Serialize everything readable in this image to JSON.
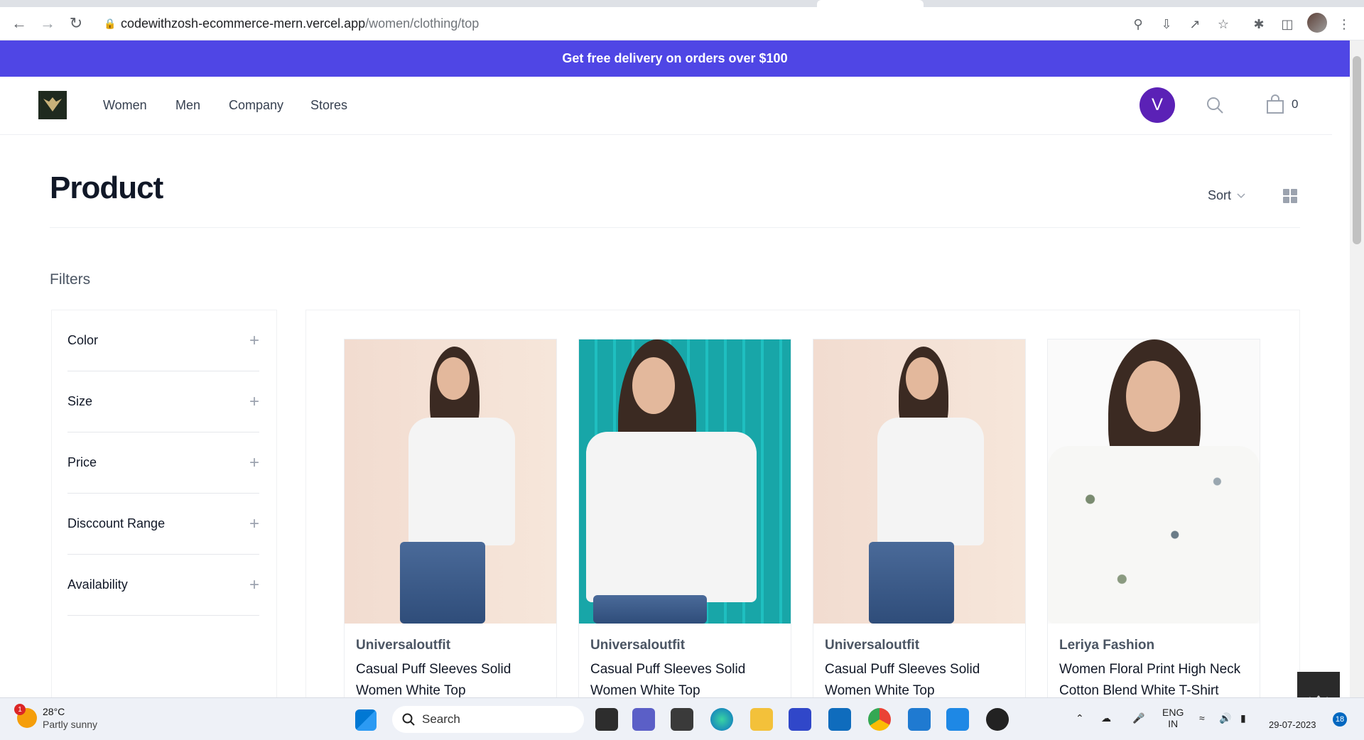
{
  "browser": {
    "url_domain": "codewithzosh-ecommerce-mern.vercel.app",
    "url_path": "/women/clothing/top"
  },
  "banner": {
    "text": "Get free delivery on orders over $100"
  },
  "nav": {
    "links": [
      "Women",
      "Men",
      "Company",
      "Stores"
    ],
    "avatar_letter": "V",
    "cart_count": "0"
  },
  "page": {
    "title": "Product",
    "sort_label": "Sort",
    "filters_title": "Filters"
  },
  "filters": [
    "Color",
    "Size",
    "Price",
    "Disccount Range",
    "Availability"
  ],
  "products": [
    {
      "brand": "Universaloutfit",
      "title": "Casual Puff Sleeves Solid Women White Top"
    },
    {
      "brand": "Universaloutfit",
      "title": "Casual Puff Sleeves Solid Women White Top"
    },
    {
      "brand": "Universaloutfit",
      "title": "Casual Puff Sleeves Solid Women White Top"
    },
    {
      "brand": "Leriya Fashion",
      "title": "Women Floral Print High Neck Cotton Blend White T-Shirt"
    }
  ],
  "taskbar": {
    "weather_temp": "28°C",
    "weather_cond": "Partly sunny",
    "weather_badge": "1",
    "search_label": "Search",
    "lang_1": "ENG",
    "lang_2": "IN",
    "date": "29-07-2023",
    "notifications": "18"
  },
  "colors": {
    "banner": "#4f46e5",
    "avatar": "#5b21b6"
  }
}
